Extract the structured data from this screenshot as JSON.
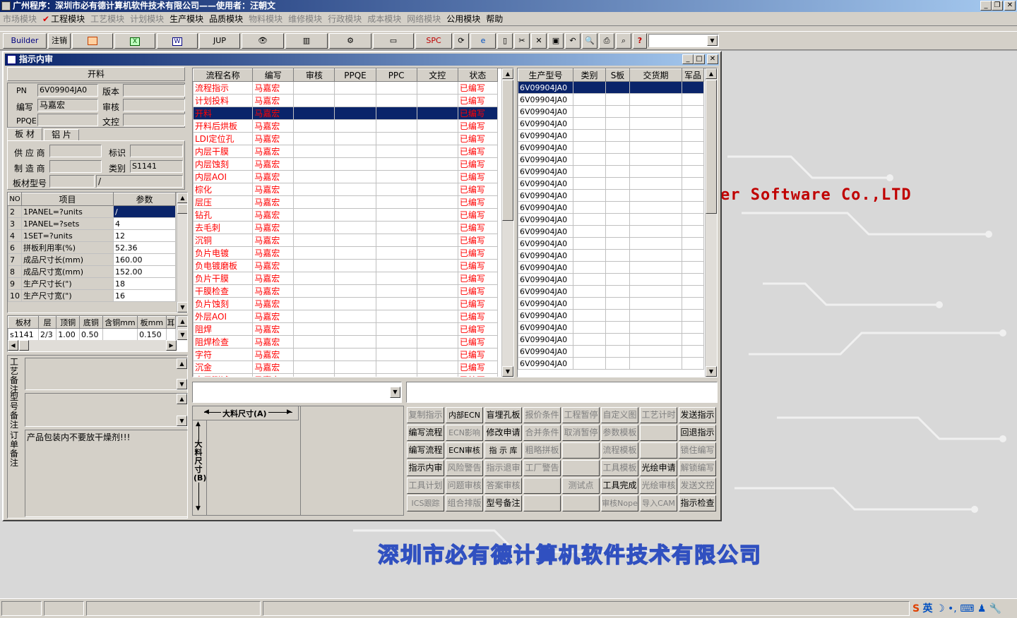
{
  "app_title": "广州程序：深圳市必有德计算机软件技术有限公司——使用者：汪朝文",
  "menu": [
    {
      "label": "市场模块",
      "enabled": false
    },
    {
      "label": "工程模块",
      "enabled": true,
      "checked": true
    },
    {
      "label": "工艺模块",
      "enabled": false
    },
    {
      "label": "计划模块",
      "enabled": false
    },
    {
      "label": "生产模块",
      "enabled": true
    },
    {
      "label": "品质模块",
      "enabled": true
    },
    {
      "label": "物料模块",
      "enabled": false
    },
    {
      "label": "维修模块",
      "enabled": false
    },
    {
      "label": "行政模块",
      "enabled": false
    },
    {
      "label": "成本模块",
      "enabled": false
    },
    {
      "label": "网络模块",
      "enabled": false
    },
    {
      "label": "公用模块",
      "enabled": true
    },
    {
      "label": "帮助",
      "enabled": true
    }
  ],
  "toolbar": {
    "builder": "Builder",
    "logout": "注销",
    "jup": "JUP",
    "spc": "SPC"
  },
  "window_title": "指示内审",
  "left": {
    "section_title": "开料",
    "pn_label": "PN",
    "pn_value": "6V09904JA0",
    "version_label": "版本",
    "version_value": "",
    "writer_label": "编写",
    "writer_value": "马嘉宏",
    "review_label": "审核",
    "review_value": "",
    "ppqe_label": "PPQE",
    "ppqe_value": "",
    "doc_label": "文控",
    "doc_value": "",
    "tab1": "板 材",
    "tab2": "铝 片",
    "supplier_label": "供 应 商",
    "supplier_value": "",
    "mark_label": "标识",
    "mark_value": "",
    "maker_label": "制 造 商",
    "maker_value": "",
    "category_label": "类别",
    "category_value": "S1141",
    "board_model_label": "板材型号",
    "board_model_value": "",
    "board_model_value2": "/",
    "param_headers": [
      "NO",
      "项目",
      "参数"
    ],
    "params": [
      [
        "2",
        "1PANEL=?units",
        "/"
      ],
      [
        "3",
        "1PANEL=?sets",
        "4"
      ],
      [
        "4",
        "1SET=?units",
        "12"
      ],
      [
        "6",
        "拼板利用率(%)",
        "52.36"
      ],
      [
        "7",
        "成品尺寸长(mm)",
        "160.00"
      ],
      [
        "8",
        "成品尺寸宽(mm)",
        "152.00"
      ],
      [
        "9",
        "生产尺寸长(\")",
        "18"
      ],
      [
        "10",
        "生产尺寸宽(\")",
        "16"
      ]
    ],
    "mat_headers": [
      "板材",
      "层",
      "顶铜",
      "底铜",
      "含铜mm",
      "板mm",
      "耳"
    ],
    "mat_row": [
      "s1141",
      "2/3",
      "1.00",
      "0.50",
      "",
      "0.150",
      ""
    ],
    "note1_label": "工艺备注",
    "note2_label": "型号备注",
    "note3_label": "订单备注",
    "note3_value": "产品包装内不要放干燥剂!!!"
  },
  "process": {
    "headers": [
      "流程名称",
      "编写",
      "审核",
      "PPQE",
      "PPC",
      "文控",
      "状态"
    ],
    "rows": [
      [
        "流程指示",
        "马嘉宏",
        "已编写"
      ],
      [
        "计划投料",
        "马嘉宏",
        "已编写"
      ],
      [
        "开料",
        "马嘉宏",
        "已编写"
      ],
      [
        "开料后烘板",
        "马嘉宏",
        "已编写"
      ],
      [
        "LDI定位孔",
        "马嘉宏",
        "已编写"
      ],
      [
        "内层干膜",
        "马嘉宏",
        "已编写"
      ],
      [
        "内层蚀刻",
        "马嘉宏",
        "已编写"
      ],
      [
        "内层AOI",
        "马嘉宏",
        "已编写"
      ],
      [
        "棕化",
        "马嘉宏",
        "已编写"
      ],
      [
        "层压",
        "马嘉宏",
        "已编写"
      ],
      [
        "钻孔",
        "马嘉宏",
        "已编写"
      ],
      [
        "去毛刺",
        "马嘉宏",
        "已编写"
      ],
      [
        "沉铜",
        "马嘉宏",
        "已编写"
      ],
      [
        "负片电镀",
        "马嘉宏",
        "已编写"
      ],
      [
        "负电镀磨板",
        "马嘉宏",
        "已编写"
      ],
      [
        "负片干膜",
        "马嘉宏",
        "已编写"
      ],
      [
        "干膜检查",
        "马嘉宏",
        "已编写"
      ],
      [
        "负片蚀刻",
        "马嘉宏",
        "已编写"
      ],
      [
        "外层AOI",
        "马嘉宏",
        "已编写"
      ],
      [
        "阻焊",
        "马嘉宏",
        "已编写"
      ],
      [
        "阻焊检查",
        "马嘉宏",
        "已编写"
      ],
      [
        "字符",
        "马嘉宏",
        "已编写"
      ],
      [
        "沉金",
        "马嘉宏",
        "已编写"
      ],
      [
        "电子测试",
        "马嘉宏",
        "已编写"
      ]
    ],
    "selected_index": 2
  },
  "models": {
    "headers": [
      "生产型号",
      "类别",
      "S板",
      "交货期",
      "军品"
    ],
    "rows": [
      "6V09904JA0",
      "6V09904JA0",
      "6V09904JA0",
      "6V09904JA0",
      "6V09904JA0",
      "6V09904JA0",
      "6V09904JA0",
      "6V09904JA0",
      "6V09904JA0",
      "6V09904JA0",
      "6V09904JA0",
      "6V09904JA0",
      "6V09904JA0",
      "6V09904JA0",
      "6V09904JA0",
      "6V09904JA0",
      "6V09904JA0",
      "6V09904JA0",
      "6V09904JA0",
      "6V09904JA0",
      "6V09904JA0",
      "6V09904JA0",
      "6V09904JA0",
      "6V09904JA0"
    ]
  },
  "dimension": {
    "a_label": "大料尺寸(A)",
    "b_label": "大料尺寸(B)"
  },
  "buttons": [
    [
      {
        "t": "复制指示",
        "e": false
      },
      {
        "t": "内部ECN",
        "e": true
      },
      {
        "t": "盲埋孔板",
        "e": true
      },
      {
        "t": "报价条件",
        "e": false
      },
      {
        "t": "工程暂停",
        "e": false
      },
      {
        "t": "自定义图",
        "e": false
      },
      {
        "t": "工艺计时",
        "e": false
      },
      {
        "t": "发送指示",
        "e": true
      }
    ],
    [
      {
        "t": "编写流程",
        "e": true
      },
      {
        "t": "ECN影响",
        "e": false
      },
      {
        "t": "修改申请",
        "e": true
      },
      {
        "t": "合并条件",
        "e": false
      },
      {
        "t": "取消暂停",
        "e": false
      },
      {
        "t": "参数模板",
        "e": false
      },
      {
        "t": "",
        "e": false
      },
      {
        "t": "回退指示",
        "e": true
      }
    ],
    [
      {
        "t": "编写流程",
        "e": true
      },
      {
        "t": "ECN审核",
        "e": true
      },
      {
        "t": "指 示 库",
        "e": true
      },
      {
        "t": "粗略拼板",
        "e": false
      },
      {
        "t": "",
        "e": false
      },
      {
        "t": "流程模板",
        "e": false
      },
      {
        "t": "",
        "e": false
      },
      {
        "t": "锁住编写",
        "e": false
      }
    ],
    [
      {
        "t": "指示内审",
        "e": true
      },
      {
        "t": "风险警告",
        "e": false
      },
      {
        "t": "指示退审",
        "e": false
      },
      {
        "t": "工厂警告",
        "e": false
      },
      {
        "t": "",
        "e": false
      },
      {
        "t": "工具模板",
        "e": false
      },
      {
        "t": "光绘申请",
        "e": true
      },
      {
        "t": "解锁编写",
        "e": false
      }
    ],
    [
      {
        "t": "工具计划",
        "e": false
      },
      {
        "t": "问题审核",
        "e": false
      },
      {
        "t": "答案审核",
        "e": false
      },
      {
        "t": "",
        "e": false
      },
      {
        "t": "测试点",
        "e": false
      },
      {
        "t": "工具完成",
        "e": true
      },
      {
        "t": "光绘审核",
        "e": false
      },
      {
        "t": "发送文控",
        "e": false
      }
    ],
    [
      {
        "t": "ICS跟踪",
        "e": false
      },
      {
        "t": "组合排版",
        "e": false
      },
      {
        "t": "型号备注",
        "e": true
      },
      {
        "t": "",
        "e": false
      },
      {
        "t": "",
        "e": false
      },
      {
        "t": "审核Nope",
        "e": false
      },
      {
        "t": "导入CAM",
        "e": false
      },
      {
        "t": "指示检查",
        "e": true
      }
    ]
  ],
  "background": {
    "english": "er Software Co.,LTD",
    "company": "深圳市必有德计算机软件技术有限公司"
  },
  "tray": {
    "ime": "英"
  }
}
